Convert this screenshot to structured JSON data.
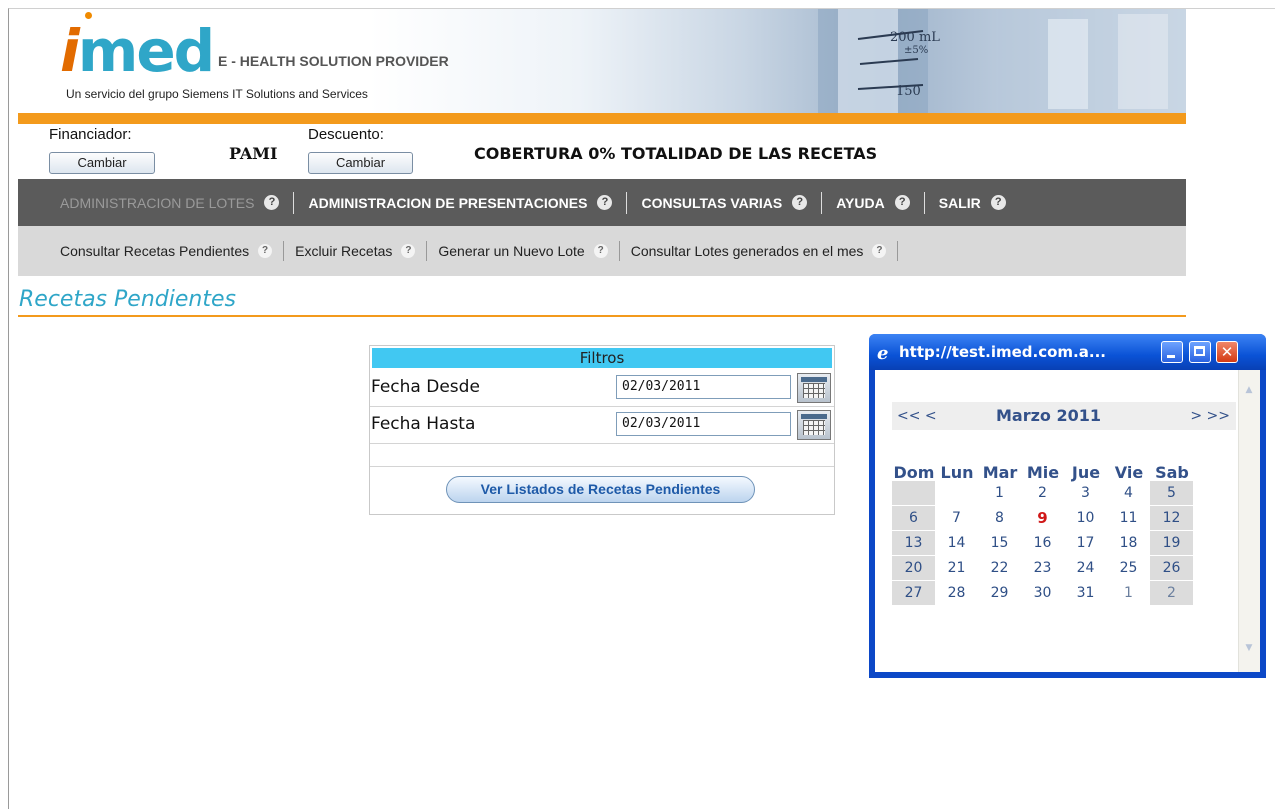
{
  "header": {
    "logo_letter": "i",
    "logo_text": "med",
    "tagline": "E - HEALTH SOLUTION PROVIDER",
    "subline": "Un servicio del grupo Siemens IT Solutions and Services",
    "beaker_label_1": "200 mL",
    "beaker_label_2": "±5%",
    "beaker_label_3": "150"
  },
  "financiador": {
    "label": "Financiador:",
    "button": "Cambiar",
    "value": "PAMI"
  },
  "descuento": {
    "label": "Descuento:",
    "button": "Cambiar",
    "value": "COBERTURA 0% TOTALIDAD DE LAS RECETAS"
  },
  "main_nav": [
    {
      "label": "ADMINISTRACION DE LOTES",
      "active": true
    },
    {
      "label": "ADMINISTRACION DE PRESENTACIONES"
    },
    {
      "label": "CONSULTAS VARIAS"
    },
    {
      "label": "AYUDA"
    },
    {
      "label": "SALIR"
    }
  ],
  "help_glyph": "?",
  "sub_nav": [
    {
      "label": "Consultar Recetas Pendientes"
    },
    {
      "label": "Excluir Recetas"
    },
    {
      "label": "Generar un Nuevo Lote"
    },
    {
      "label": "Consultar Lotes generados en el mes"
    }
  ],
  "page_title": "Recetas Pendientes",
  "filters": {
    "header": "Filtros",
    "fecha_desde_label": "Fecha Desde",
    "fecha_desde_value": "02/03/2011",
    "fecha_hasta_label": "Fecha Hasta",
    "fecha_hasta_value": "02/03/2011",
    "submit": "Ver Listados de Recetas Pendientes"
  },
  "popup": {
    "title": "http://test.imed.com.a...",
    "calendar": {
      "prev_year": "<<",
      "prev_month": "<",
      "month_label": "Marzo 2011",
      "next_month": ">",
      "next_year": ">>",
      "day_headers": [
        "Dom",
        "Lun",
        "Mar",
        "Mie",
        "Jue",
        "Vie",
        "Sab"
      ],
      "weeks": [
        [
          "",
          "",
          "1",
          "2",
          "3",
          "4",
          "5"
        ],
        [
          "6",
          "7",
          "8",
          "9",
          "10",
          "11",
          "12"
        ],
        [
          "13",
          "14",
          "15",
          "16",
          "17",
          "18",
          "19"
        ],
        [
          "20",
          "21",
          "22",
          "23",
          "24",
          "25",
          "26"
        ],
        [
          "27",
          "28",
          "29",
          "30",
          "31",
          "1",
          "2"
        ]
      ],
      "today": "9"
    }
  },
  "colors": {
    "accent_cyan": "#2fa6c8",
    "accent_orange": "#f39a1c",
    "nav_dark": "#5b5b5b",
    "filter_header": "#41c8f2",
    "today_red": "#d01818"
  }
}
